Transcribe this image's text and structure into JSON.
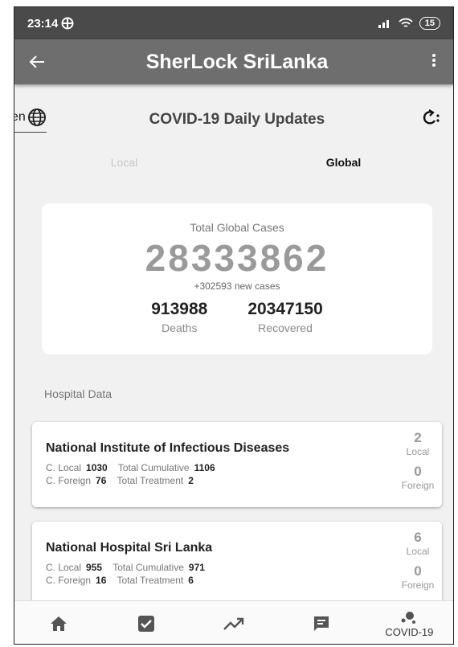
{
  "status_bar": {
    "time": "23:14",
    "battery": "15"
  },
  "app_bar": {
    "title": "SherLock SriLanka"
  },
  "top": {
    "language": "en",
    "heading": "COVID-19 Daily Updates"
  },
  "tabs": {
    "local": "Local",
    "global": "Global"
  },
  "global_card": {
    "label": "Total Global Cases",
    "total": "28333862",
    "new_cases": "+302593 new cases",
    "deaths": "913988",
    "deaths_label": "Deaths",
    "recovered": "20347150",
    "recovered_label": "Recovered"
  },
  "hospital_section": {
    "title": "Hospital Data"
  },
  "hospitals": [
    {
      "name": "National Institute of Infectious Diseases",
      "c_local_label": "C. Local",
      "c_local": "1030",
      "total_cum_label": "Total Cumulative",
      "total_cum": "1106",
      "c_foreign_label": "C. Foreign",
      "c_foreign": "76",
      "total_treat_label": "Total Treatment",
      "total_treat": "2",
      "local_count": "2",
      "local_label": "Local",
      "foreign_count": "0",
      "foreign_label": "Foreign"
    },
    {
      "name": "National Hospital Sri Lanka",
      "c_local_label": "C. Local",
      "c_local": "955",
      "total_cum_label": "Total Cumulative",
      "total_cum": "971",
      "c_foreign_label": "C. Foreign",
      "c_foreign": "16",
      "total_treat_label": "Total Treatment",
      "total_treat": "6",
      "local_count": "6",
      "local_label": "Local",
      "foreign_count": "0",
      "foreign_label": "Foreign"
    }
  ],
  "bottom_nav": {
    "covid_label": "COVID-19"
  },
  "icons": {
    "back": "arrow-left-icon",
    "menu": "more-vert-icon",
    "language": "globe-icon",
    "refresh": "refresh-icon",
    "home": "home-icon",
    "check": "check-box-icon",
    "trend": "trending-up-icon",
    "chat": "chat-icon",
    "covid": "virus-icon"
  }
}
